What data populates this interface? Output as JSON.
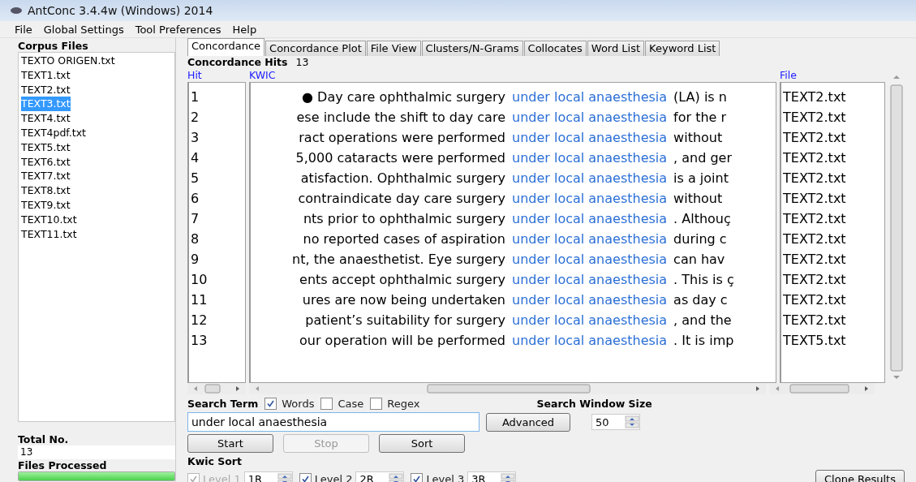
{
  "window": {
    "title": "AntConc 3.4.4w (Windows) 2014"
  },
  "menu": [
    "File",
    "Global Settings",
    "Tool Preferences",
    "Help"
  ],
  "corpus_files": {
    "title": "Corpus Files",
    "items": [
      {
        "name": "TEXTO ORIGEN.txt",
        "selected": false
      },
      {
        "name": "TEXT1.txt",
        "selected": false
      },
      {
        "name": "TEXT2.txt",
        "selected": false
      },
      {
        "name": "TEXT3.txt",
        "selected": true
      },
      {
        "name": "TEXT4.txt",
        "selected": false
      },
      {
        "name": "TEXT4pdf.txt",
        "selected": false
      },
      {
        "name": "TEXT5.txt",
        "selected": false
      },
      {
        "name": "TEXT6.txt",
        "selected": false
      },
      {
        "name": "TEXT7.txt",
        "selected": false
      },
      {
        "name": "TEXT8.txt",
        "selected": false
      },
      {
        "name": "TEXT9.txt",
        "selected": false
      },
      {
        "name": "TEXT10.txt",
        "selected": false
      },
      {
        "name": "TEXT11.txt",
        "selected": false
      }
    ]
  },
  "total": {
    "label": "Total No.",
    "value": "13"
  },
  "files_processed": {
    "label": "Files Processed",
    "level": 1
  },
  "tabs": [
    {
      "label": "Concordance",
      "selected": true
    },
    {
      "label": "Concordance Plot",
      "selected": false
    },
    {
      "label": "File View",
      "selected": false
    },
    {
      "label": "Clusters/N-Grams",
      "selected": false
    },
    {
      "label": "Collocates",
      "selected": false
    },
    {
      "label": "Word List",
      "selected": false
    },
    {
      "label": "Keyword List",
      "selected": false
    }
  ],
  "hits": {
    "label": "Concordance Hits",
    "value": "13"
  },
  "table": {
    "columns": [
      "Hit",
      "KWIC",
      "File"
    ],
    "rows": [
      {
        "hit": "1",
        "left": "●  Day care ophthalmic surgery",
        "keyword": "under local anaesthesia",
        "right": "(LA) is n",
        "file": "TEXT2.txt"
      },
      {
        "hit": "2",
        "left": "ese include the shift to day care",
        "keyword": "under local anaesthesia",
        "right": "for the r",
        "file": "TEXT2.txt"
      },
      {
        "hit": "3",
        "left": "ract operations were performed",
        "keyword": "under local anaesthesia",
        "right": "without",
        "file": "TEXT2.txt"
      },
      {
        "hit": "4",
        "left": "5,000 cataracts were performed",
        "keyword": "under local anaesthesia",
        "right": ", and ger",
        "file": "TEXT2.txt"
      },
      {
        "hit": "5",
        "left": "atisfaction. Ophthalmic surgery",
        "keyword": "under local anaesthesia",
        "right": "is a joint",
        "file": "TEXT2.txt"
      },
      {
        "hit": "6",
        "left": "contraindicate day care surgery",
        "keyword": "under local anaesthesia",
        "right": "without",
        "file": "TEXT2.txt"
      },
      {
        "hit": "7",
        "left": "nts prior to ophthalmic surgery",
        "keyword": "under local anaesthesia",
        "right": ". Althouç",
        "file": "TEXT2.txt"
      },
      {
        "hit": "8",
        "left": "no reported cases of aspiration",
        "keyword": "under local anaesthesia",
        "right": "during c",
        "file": "TEXT2.txt"
      },
      {
        "hit": "9",
        "left": "nt, the anaesthetist. Eye surgery",
        "keyword": "under local anaesthesia",
        "right": "can hav",
        "file": "TEXT2.txt"
      },
      {
        "hit": "10",
        "left": "ents accept ophthalmic surgery",
        "keyword": "under local anaesthesia",
        "right": ". This is ç",
        "file": "TEXT2.txt"
      },
      {
        "hit": "11",
        "left": "ures are now being undertaken",
        "keyword": "under local anaesthesia",
        "right": "as day c",
        "file": "TEXT2.txt"
      },
      {
        "hit": "12",
        "left": "patient’s suitability for surgery",
        "keyword": "under local anaesthesia",
        "right": ", and the",
        "file": "TEXT2.txt"
      },
      {
        "hit": "13",
        "left": "our operation will be performed",
        "keyword": "under local anaesthesia",
        "right": ". It is imp",
        "file": "TEXT5.txt"
      }
    ]
  },
  "search": {
    "label": "Search Term",
    "options": [
      {
        "label": "Words",
        "checked": true
      },
      {
        "label": "Case",
        "checked": false
      },
      {
        "label": "Regex",
        "checked": false
      }
    ],
    "value": "under local anaesthesia",
    "advanced": "Advanced"
  },
  "window_size": {
    "label": "Search Window Size",
    "value": "50"
  },
  "actions": [
    {
      "label": "Start",
      "disabled": false
    },
    {
      "label": "Stop",
      "disabled": true
    },
    {
      "label": "Sort",
      "disabled": false
    }
  ],
  "kwic_sort": {
    "label": "Kwic Sort",
    "levels": [
      {
        "label": "Level 1",
        "value": "1R",
        "checked": true,
        "disabled": true
      },
      {
        "label": "Level 2",
        "value": "2R",
        "checked": true,
        "disabled": false
      },
      {
        "label": "Level 3",
        "value": "3R",
        "checked": true,
        "disabled": false
      }
    ]
  },
  "clone_button": "Clone Results"
}
